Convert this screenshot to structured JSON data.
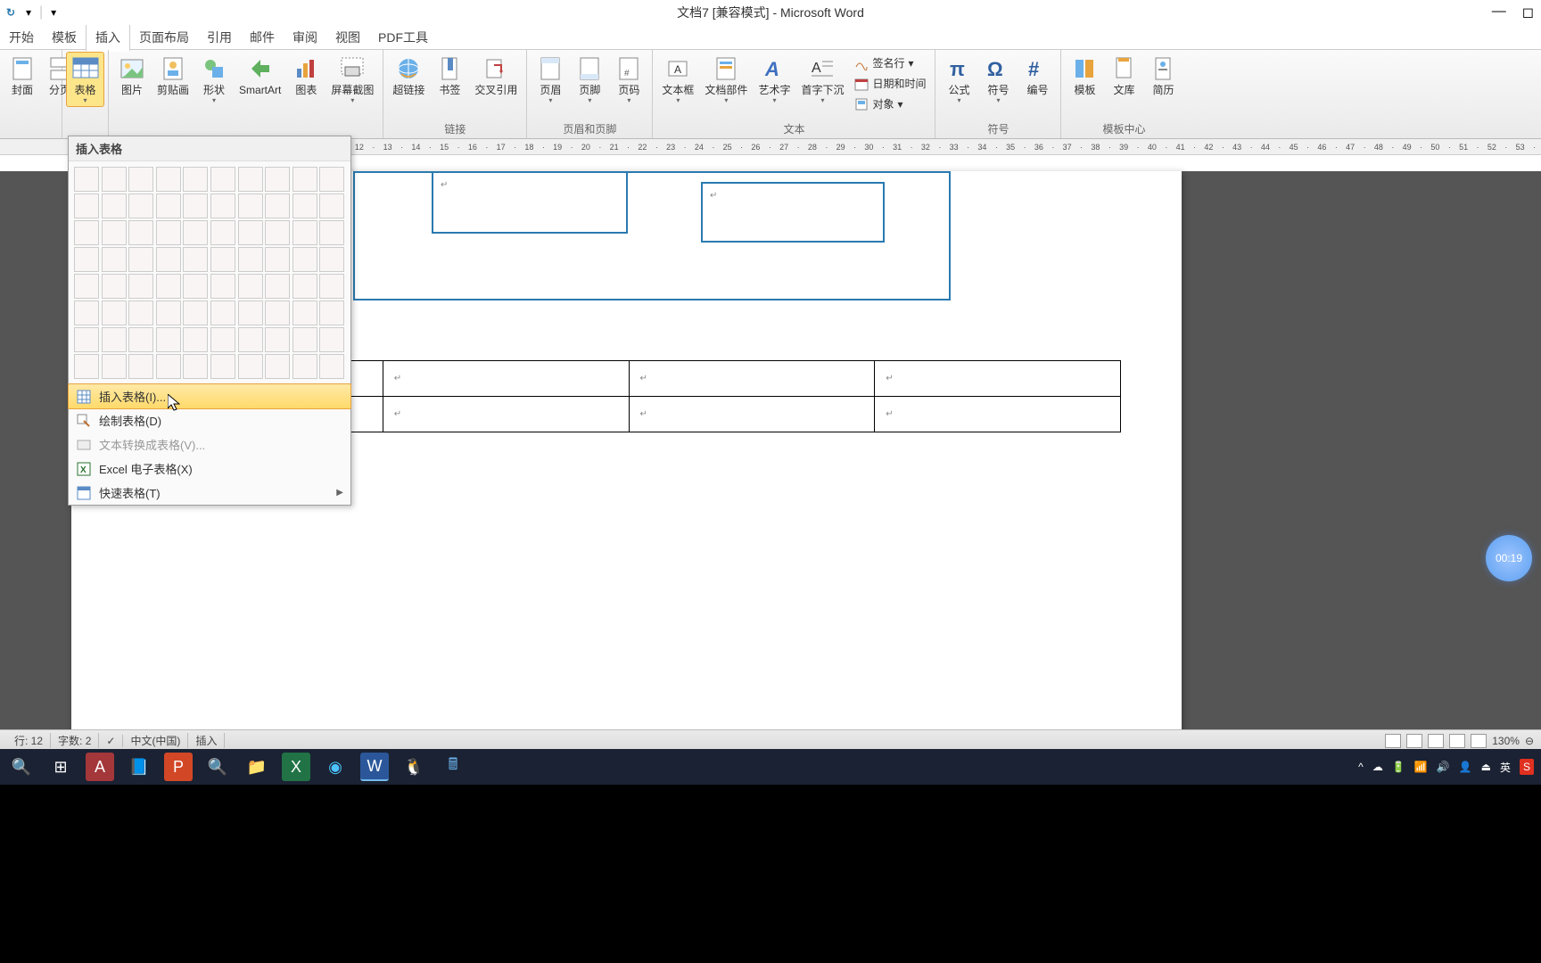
{
  "title": "文档7 [兼容模式] - Microsoft Word",
  "tabs": [
    "开始",
    "模板",
    "插入",
    "页面布局",
    "引用",
    "邮件",
    "审阅",
    "视图",
    "PDF工具"
  ],
  "activeTab": 2,
  "ribbon": {
    "pages": {
      "cover": "封面",
      "blank": "分页"
    },
    "tables": {
      "table": "表格"
    },
    "illustrations": [
      "图片",
      "剪贴画",
      "形状",
      "SmartArt",
      "图表",
      "屏幕截图"
    ],
    "links": {
      "label": "链接",
      "items": [
        "超链接",
        "书签",
        "交叉引用"
      ]
    },
    "headerFooter": {
      "label": "页眉和页脚",
      "items": [
        "页眉",
        "页脚",
        "页码"
      ]
    },
    "text": {
      "label": "文本",
      "items": [
        "文本框",
        "文档部件",
        "艺术字",
        "首字下沉"
      ],
      "small": [
        "签名行",
        "日期和时间",
        "对象"
      ]
    },
    "symbols": {
      "label": "符号",
      "items": [
        "公式",
        "符号",
        "编号"
      ]
    },
    "templates": {
      "label": "模板中心",
      "items": [
        "模板",
        "文库",
        "简历"
      ]
    }
  },
  "tableMenu": {
    "title": "插入表格",
    "items": [
      {
        "label": "插入表格(I)...",
        "highlighted": true
      },
      {
        "label": "绘制表格(D)"
      },
      {
        "label": "文本转换成表格(V)...",
        "disabled": true
      },
      {
        "label": "Excel 电子表格(X)"
      },
      {
        "label": "快速表格(T)",
        "submenu": true
      }
    ]
  },
  "status": {
    "line": "行: 12",
    "words": "字数: 2",
    "lang": "中文(中国)",
    "mode": "插入",
    "zoom": "130%"
  },
  "taskbar": {
    "ime": "英"
  },
  "timer": "00:19"
}
